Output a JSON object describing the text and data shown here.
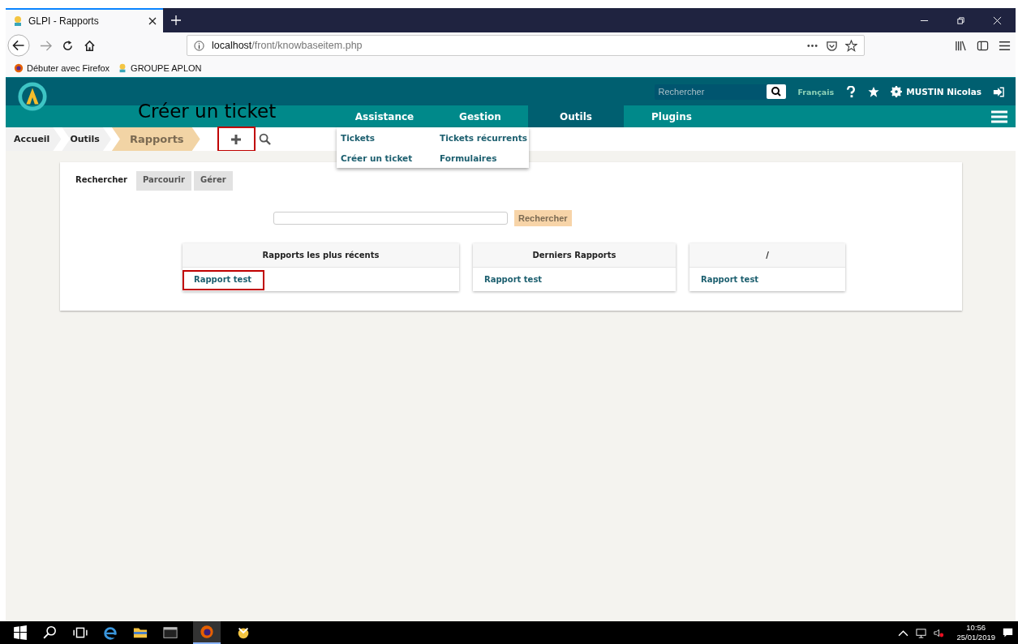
{
  "browser": {
    "tab_title": "GLPI - Rapports",
    "url_host": "localhost",
    "url_path": "/front/knowbaseitem.php",
    "bookmarks": [
      {
        "label": "Débuter avec Firefox",
        "kind": "firefox"
      },
      {
        "label": "GROUPE APLON",
        "kind": "glpi"
      }
    ]
  },
  "header": {
    "search_placeholder": "Rechercher",
    "language": "Français",
    "user": "MUSTIN Nicolas"
  },
  "nav": [
    {
      "label": "Assistance",
      "selected": false
    },
    {
      "label": "Gestion",
      "selected": false
    },
    {
      "label": "Outils",
      "selected": true
    },
    {
      "label": "Plugins",
      "selected": false
    }
  ],
  "dropdown": [
    "Tickets",
    "Tickets récurrents",
    "Créer un ticket",
    "Formulaires"
  ],
  "annotation": "Créer un ticket",
  "breadcrumb": [
    {
      "label": "Accueil",
      "selected": false
    },
    {
      "label": "Outils",
      "selected": false
    },
    {
      "label": "Rapports",
      "selected": true
    }
  ],
  "add_highlighted": true,
  "tabs": [
    {
      "label": "Rechercher",
      "selected": true
    },
    {
      "label": "Parcourir",
      "selected": false
    },
    {
      "label": "Gérer",
      "selected": false
    }
  ],
  "search_button": "Rechercher",
  "panels": [
    {
      "title": "Rapports les plus récents",
      "link": "Rapport test",
      "highlighted": true
    },
    {
      "title": "Derniers Rapports",
      "link": "Rapport test",
      "highlighted": false
    },
    {
      "title": "/",
      "link": "Rapport test",
      "highlighted": false
    }
  ],
  "taskbar": {
    "time": "10:56",
    "date": "25/01/2019"
  }
}
